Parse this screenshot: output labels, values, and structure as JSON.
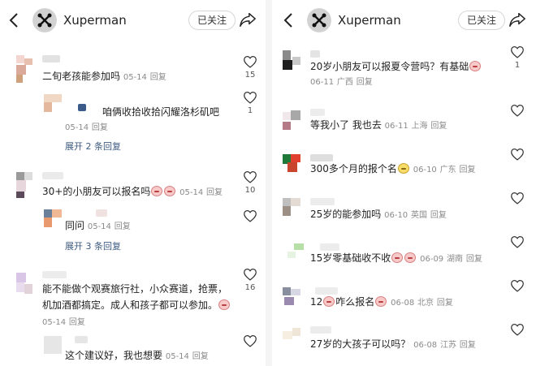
{
  "left_panel": {
    "header": {
      "username": "Xuperman",
      "follow_label": "已关注"
    },
    "comments": [
      {
        "text": "二旬老孩能参加吗",
        "date": "05-14",
        "reply": "回复",
        "likes": "15"
      },
      {
        "text": "咱俩收拾收拾闪耀洛杉矶吧",
        "date": "05-14",
        "reply": "回复",
        "likes": "1",
        "expand": "展开 2 条回复"
      },
      {
        "text": "30+的小朋友可以报名吗",
        "date": "05-14",
        "reply": "回复",
        "likes": "10"
      },
      {
        "text": "同问",
        "date": "05-14",
        "reply": "回复",
        "expand": "展开 3 条回复"
      },
      {
        "text": "能不能做个观赛旅行社，小众赛道，抢票，机加酒都搞定。成人和孩子都可以参加。",
        "date": "05-14",
        "reply": "回复",
        "likes": "16"
      },
      {
        "text": "这个建议好，我也想要",
        "date": "05-14",
        "reply": "回复"
      }
    ]
  },
  "right_panel": {
    "header": {
      "username": "Xuperman",
      "follow_label": "已关注"
    },
    "comments": [
      {
        "text": "20岁小朋友可以报夏令营吗？有基础",
        "date": "06-11",
        "location": "广西",
        "reply": "回复",
        "likes": "1"
      },
      {
        "text": "等我小了 我也去",
        "date": "06-11",
        "location": "上海",
        "reply": "回复"
      },
      {
        "text": "300多个月的报个名",
        "date": "06-10",
        "location": "广东",
        "reply": "回复"
      },
      {
        "text": "25岁的能参加吗",
        "date": "06-10",
        "location": "英国",
        "reply": "回复"
      },
      {
        "text": "15岁零基础收不收",
        "date": "06-09",
        "location": "湖南",
        "reply": "回复"
      },
      {
        "text": "12",
        "text2": "咋么报名",
        "date": "06-08",
        "location": "北京",
        "reply": "回复"
      },
      {
        "text": "27岁的大孩子可以吗？",
        "date": "06-08",
        "location": "江苏",
        "reply": "回复"
      }
    ]
  },
  "icons": {
    "back": "chevron-left-icon",
    "share": "share-arrow-icon",
    "heart": "heart-outline-icon",
    "emoji": "emoji-sticker-icon"
  },
  "colors": {
    "link": "#3d5a80",
    "meta": "#8a8a8a",
    "follow_border": "#d6d6d6"
  }
}
